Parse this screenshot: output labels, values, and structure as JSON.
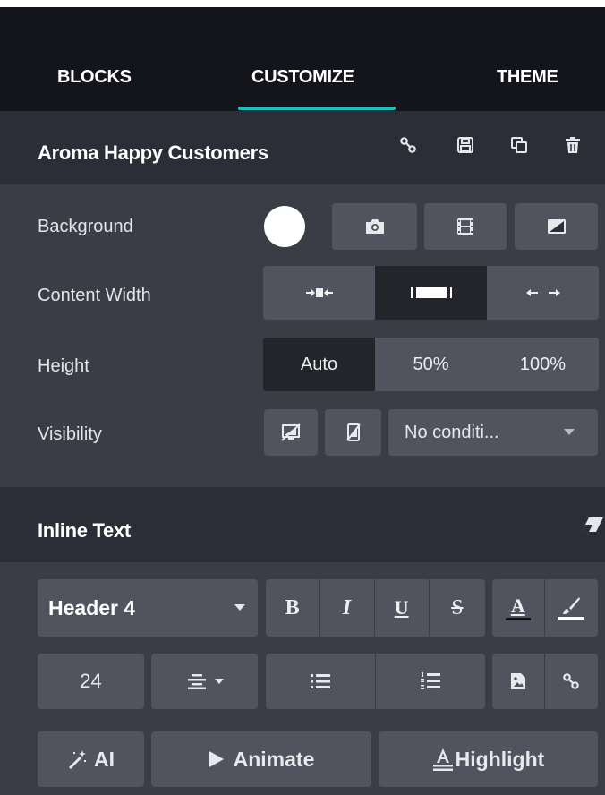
{
  "tabs": [
    {
      "label": "BLOCKS"
    },
    {
      "label": "CUSTOMIZE"
    },
    {
      "label": "THEME"
    }
  ],
  "snippet": {
    "title": "Aroma Happy Customers",
    "icons": [
      "link-icon",
      "save-icon",
      "duplicate-icon",
      "trash-icon"
    ]
  },
  "options": {
    "background": {
      "label": "Background",
      "color": "#ffffff",
      "icons": [
        "camera-icon",
        "film-icon",
        "gradient-icon"
      ]
    },
    "content_width": {
      "label": "Content Width",
      "selected": 1
    },
    "height": {
      "label": "Height",
      "options": [
        "Auto",
        "50%",
        "100%"
      ],
      "selected": 0
    },
    "visibility": {
      "label": "Visibility",
      "select_value": "No conditi..."
    }
  },
  "inline_text": {
    "title": "Inline Text",
    "style_select": "Header 4",
    "bold": "B",
    "italic": "I",
    "underline": "U",
    "strike": "S",
    "font_color": "A",
    "font_size": "24",
    "ai_label": "AI",
    "animate_label": "Animate",
    "highlight_label": "Highlight"
  },
  "colors": {
    "accent": "#17c2c2",
    "tabs_bg": "#14151a",
    "header_bg": "#2b2e36",
    "panel_bg": "#3a3d46",
    "button_bg": "#51545e",
    "active_bg": "#23252b"
  }
}
